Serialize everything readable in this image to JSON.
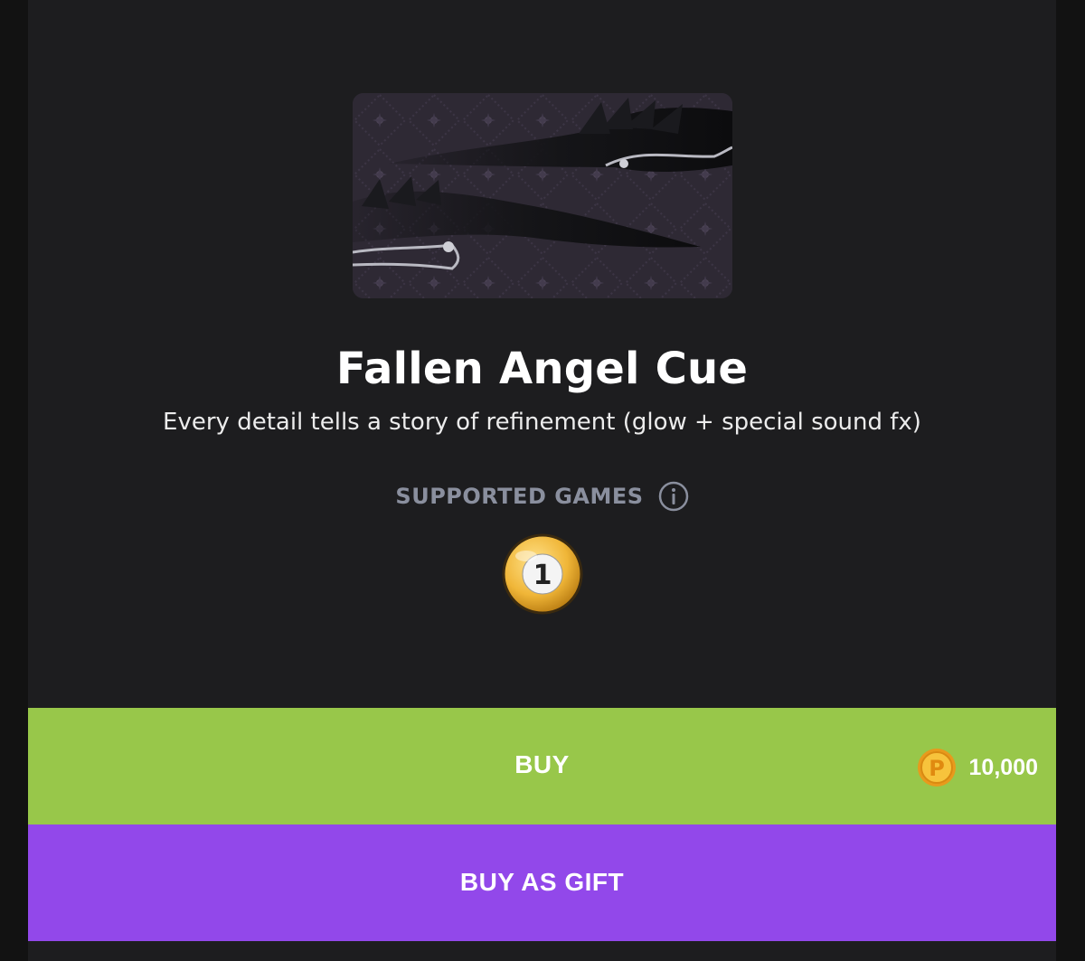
{
  "product": {
    "title": "Fallen Angel Cue",
    "description": "Every detail tells a story of refinement (glow + special sound fx)",
    "image_icon": "winged-cue-image"
  },
  "supported_games": {
    "label": "SUPPORTED GAMES",
    "info_icon": "info-icon",
    "games": [
      {
        "icon": "billiard-ball-1-icon",
        "number": "1"
      }
    ]
  },
  "purchase": {
    "buy_label": "BUY",
    "price": "10,000",
    "currency_icon": "coin-icon",
    "gift_label": "BUY AS GIFT"
  },
  "colors": {
    "background": "#1d1d1f",
    "buy": "#98c74a",
    "gift": "#9248ea",
    "muted_text": "#8a8f9e"
  }
}
